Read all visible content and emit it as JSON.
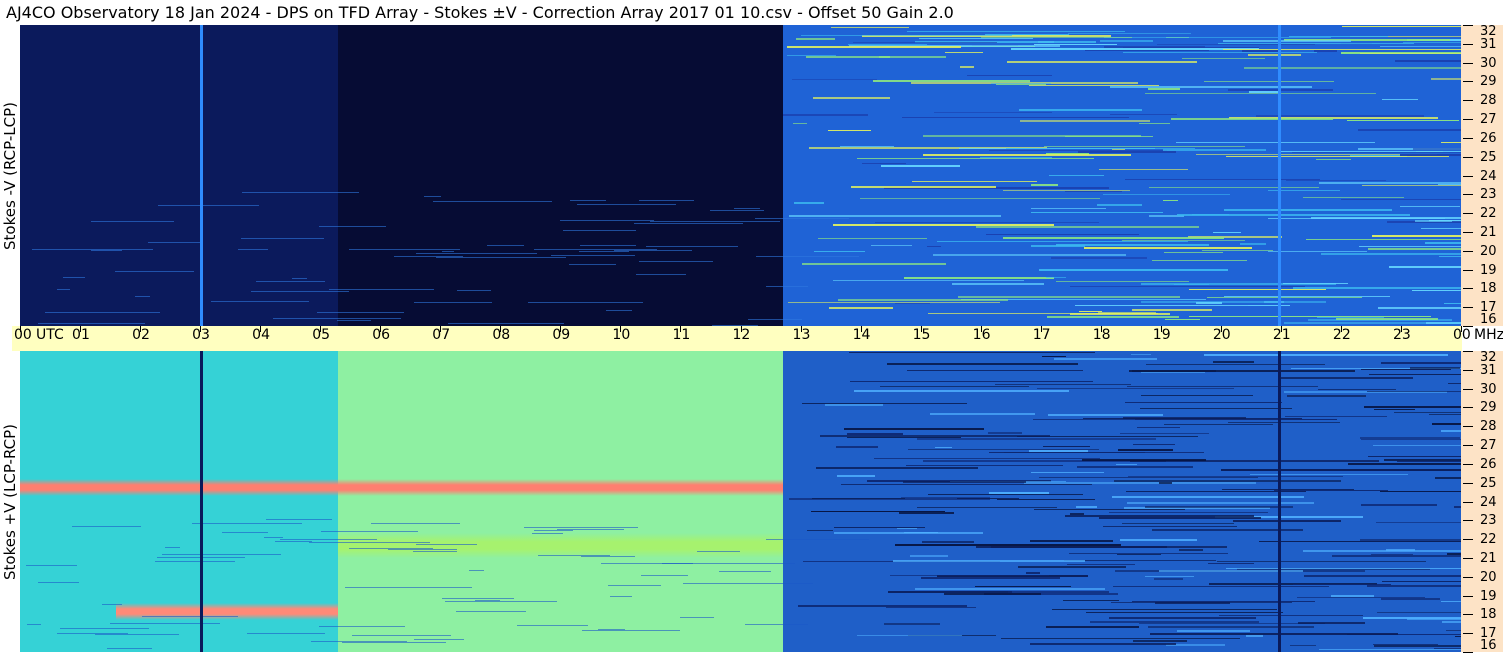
{
  "title": "AJ4CO Observatory  18 Jan 2024  -  DPS on TFD Array  -  Stokes ±V  -  Correction Array 2017 01 10.csv  -  Offset 50  Gain 2.0",
  "chart_data": [
    {
      "type": "heatmap",
      "panel": "top",
      "ylabel": "Stokes -V (RCP-LCP)",
      "x_ticks": [
        "00",
        "01",
        "02",
        "03",
        "04",
        "05",
        "06",
        "07",
        "08",
        "09",
        "10",
        "11",
        "12",
        "13",
        "14",
        "15",
        "16",
        "17",
        "18",
        "19",
        "20",
        "21",
        "22",
        "23",
        "00"
      ],
      "x_unit_label": "UTC",
      "y_ticks": [
        16,
        17,
        18,
        19,
        20,
        21,
        22,
        23,
        24,
        25,
        26,
        27,
        28,
        29,
        30,
        31,
        32
      ],
      "y_unit_label": "MHz",
      "ylim": [
        16,
        32
      ],
      "xlim_hours": [
        0,
        24
      ],
      "colormap": [
        "#04082a",
        "#0a2a9a",
        "#1e6ee8",
        "#3ab0f0",
        "#6ee8c0",
        "#d8f060",
        "#ffa040",
        "#ff5070"
      ],
      "regions": [
        {
          "from": 0.0,
          "to": 5.3,
          "color": "#0b1a5c"
        },
        {
          "from": 5.3,
          "to": 12.7,
          "color": "#060c34"
        },
        {
          "from": 12.7,
          "to": 24.0,
          "color": "#1f63d6"
        }
      ],
      "vertical_lines_hours": [
        3.0,
        20.95
      ],
      "vertical_line_color": "#2f8cff"
    },
    {
      "type": "heatmap",
      "panel": "bottom",
      "ylabel": "Stokes +V (LCP-RCP)",
      "y_ticks": [
        16,
        17,
        18,
        19,
        20,
        21,
        22,
        23,
        24,
        25,
        26,
        27,
        28,
        29,
        30,
        31,
        32
      ],
      "y_unit_label": "MHz",
      "ylim": [
        16,
        32
      ],
      "xlim_hours": [
        0,
        24
      ],
      "regions": [
        {
          "from": 0.0,
          "to": 5.3,
          "color": "#35d2d6"
        },
        {
          "from": 5.3,
          "to": 12.7,
          "color": "#8ef0a2"
        },
        {
          "from": 12.7,
          "to": 24.0,
          "color": "#1f5fc8"
        }
      ],
      "bands_mhz": [
        {
          "from": 24.3,
          "to": 25.2,
          "color": "#ff7f70",
          "start": 0.0,
          "end": 12.7
        },
        {
          "from": 17.7,
          "to": 18.6,
          "color": "#ff8a78",
          "start": 1.6,
          "end": 5.3
        },
        {
          "from": 21.0,
          "to": 22.3,
          "color": "#a6f26e",
          "start": 5.3,
          "end": 12.7
        }
      ],
      "vertical_lines_hours": [
        3.0,
        20.95
      ],
      "vertical_line_color": "#0a1a5a"
    }
  ]
}
